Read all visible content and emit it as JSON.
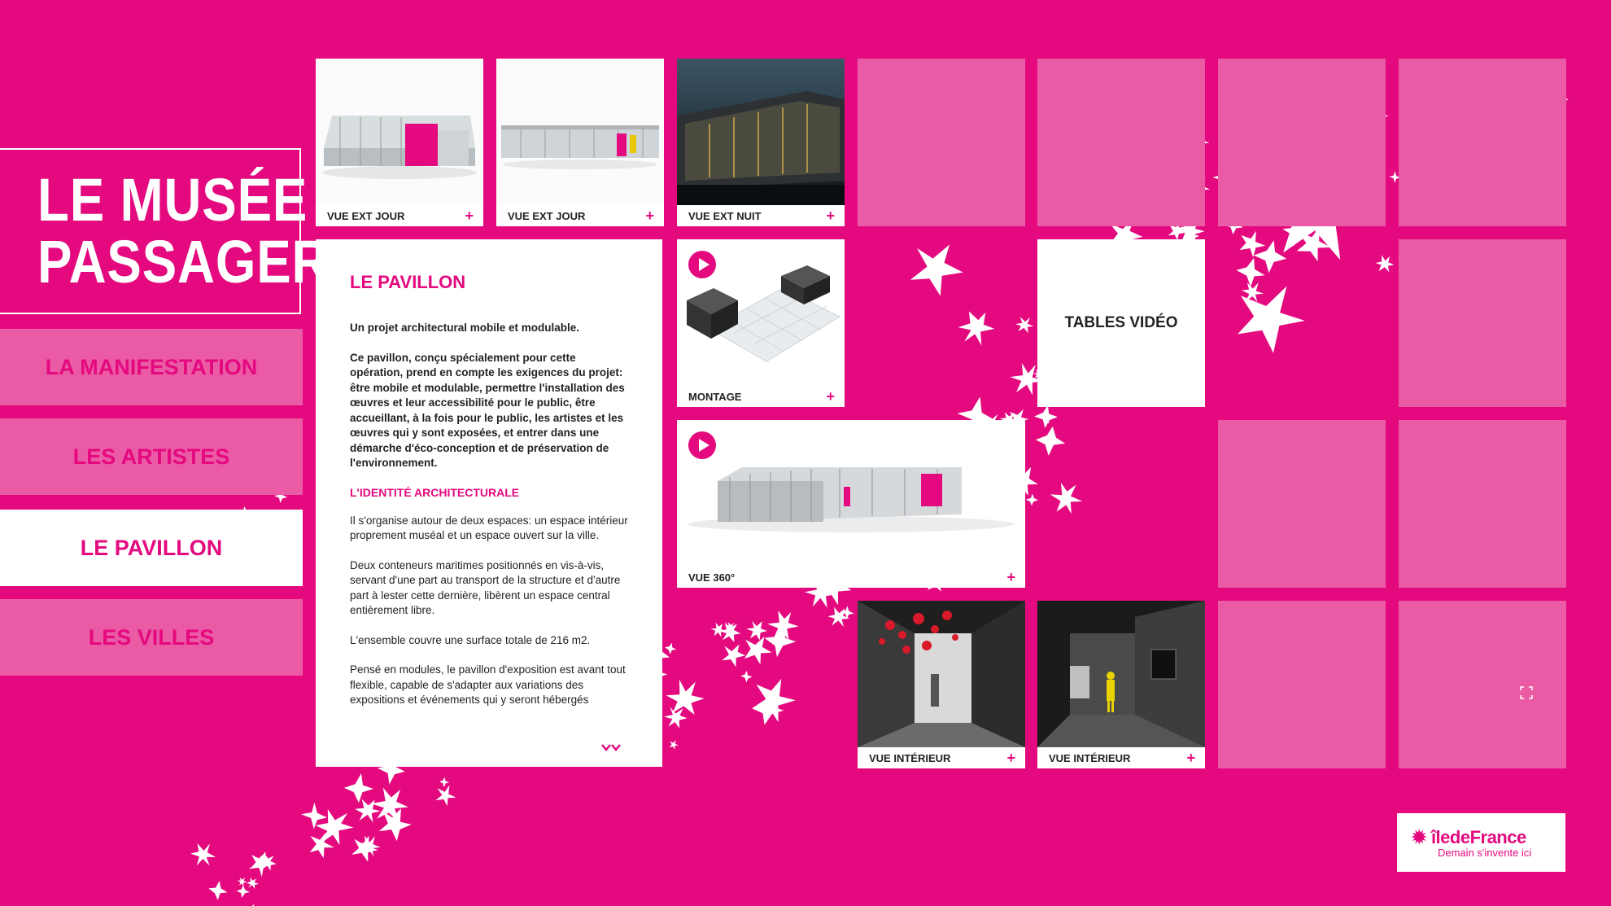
{
  "title": {
    "line1": "LE MUSÉE",
    "line2": "PASSAGER"
  },
  "nav": [
    {
      "label": "LA MANIFESTATION"
    },
    {
      "label": "LES ARTISTES"
    },
    {
      "label": "LE PAVILLON"
    },
    {
      "label": "LES VILLES"
    }
  ],
  "tiles": {
    "t1": {
      "caption": "VUE EXT JOUR"
    },
    "t2": {
      "caption": "VUE EXT JOUR"
    },
    "t3": {
      "caption": "VUE EXT NUIT"
    },
    "montage": {
      "caption": "MONTAGE"
    },
    "vue360": {
      "caption": "VUE 360°"
    },
    "int1": {
      "caption": "VUE INTÉRIEUR"
    },
    "int2": {
      "caption": "VUE INTÉRIEUR"
    },
    "tables": {
      "label": "TABLES VIDÉO"
    },
    "plus": "+"
  },
  "article": {
    "heading": "LE PAVILLON",
    "intro": "Un projet architectural mobile et modulable.",
    "lead": "Ce pavillon, conçu spécialement pour cette opération, prend en compte les exigences du projet: être mobile et modulable, permettre l'installation des œuvres et leur accessibilité pour le public, être accueillant, à la fois pour le public, les artistes et les œuvres qui y sont exposées, et entrer dans une démarche d'éco-conception et de préservation de l'environnement.",
    "subheading": "L'IDENTITÉ ARCHITECTURALE",
    "p1": "Il s'organise autour de deux espaces: un espace intérieur proprement muséal et un espace ouvert sur la ville.",
    "p2": "Deux conteneurs maritimes positionnés en vis-à-vis, servant d'une part au transport de la structure et d'autre part à lester cette dernière, libèrent un espace central entièrement libre.",
    "p3": "L'ensemble couvre une surface totale de 216 m2.",
    "p4": "Pensé en modules, le pavillon d'exposition est avant tout flexible, capable de s'adapter aux variations des expositions et événements qui y seront hébergés"
  },
  "logo": {
    "name": "îledeFrance",
    "tagline": "Demain s'invente ici"
  },
  "colors": {
    "brand": "#e4097f",
    "tile": "#eb5aa5"
  },
  "icons": [
    "play-icon",
    "plus-icon",
    "chevron-down-icon",
    "expand-icon",
    "star-icon"
  ]
}
